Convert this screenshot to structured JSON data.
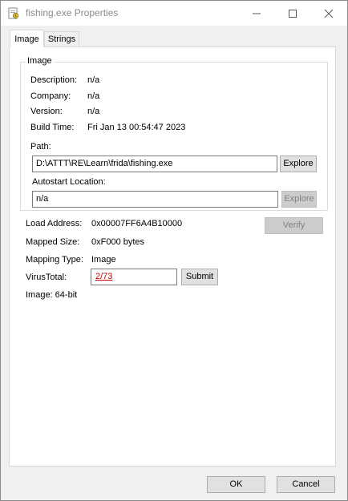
{
  "window": {
    "title": "fishing.exe Properties"
  },
  "tabs": [
    {
      "label": "Image"
    },
    {
      "label": "Strings"
    }
  ],
  "group": {
    "title": "Image",
    "description_label": "Description:",
    "description_value": "n/a",
    "company_label": "Company:",
    "company_value": "n/a",
    "version_label": "Version:",
    "version_value": "n/a",
    "buildtime_label": "Build Time:",
    "buildtime_value": "Fri Jan 13 00:54:47 2023",
    "path_label": "Path:",
    "path_value": "D:\\ATTT\\RE\\Learn\\frida\\fishing.exe",
    "path_explore": "Explore",
    "autostart_label": "Autostart Location:",
    "autostart_value": "n/a",
    "autostart_explore": "Explore"
  },
  "details": {
    "load_address_label": "Load Address:",
    "load_address_value": "0x00007FF6A4B10000",
    "verify_button": "Verify",
    "mapped_size_label": "Mapped Size:",
    "mapped_size_value": "0xF000 bytes",
    "mapping_type_label": "Mapping Type:",
    "mapping_type_value": "Image",
    "virustotal_label": "VirusTotal:",
    "virustotal_value": "2/73",
    "submit_button": "Submit",
    "image_bits": "Image: 64-bit"
  },
  "footer": {
    "ok_button": "OK",
    "cancel_button": "Cancel"
  },
  "colors": {
    "link": "#cc0000",
    "title_text": "#8c8c8c"
  },
  "icons": {
    "app": "app-icon",
    "minimize": "minimize-icon",
    "maximize": "maximize-icon",
    "close": "close-icon"
  }
}
